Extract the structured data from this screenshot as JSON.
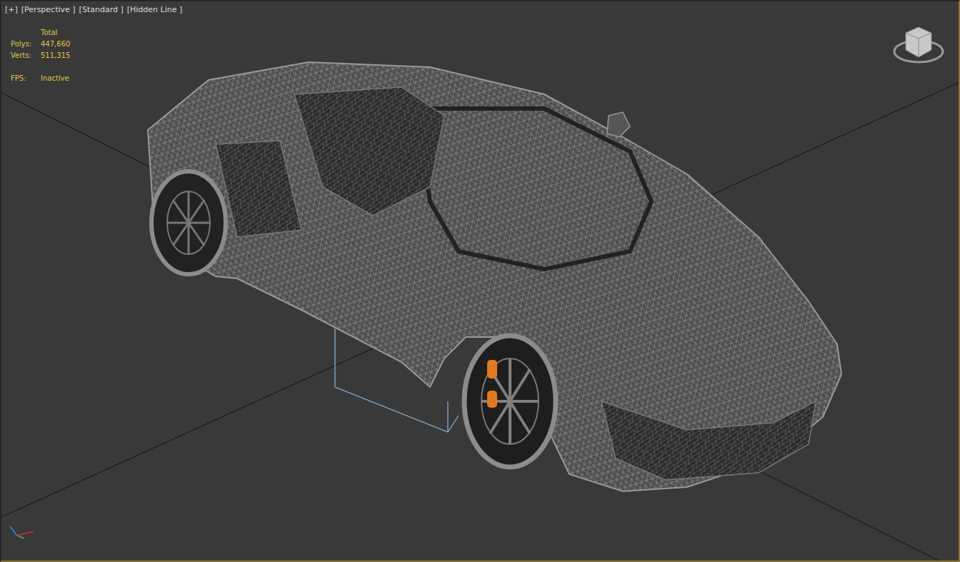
{
  "viewport": {
    "active": true,
    "labels": [
      {
        "text": "[+]"
      },
      {
        "text": "[Perspective ]"
      },
      {
        "text": "[Standard ]"
      },
      {
        "text": "[Hidden Line ]"
      }
    ]
  },
  "stats": {
    "header": "Total",
    "rows": [
      {
        "label": "Polys:",
        "value": "447,660"
      },
      {
        "label": "Verts:",
        "value": "511,315"
      }
    ],
    "fps": {
      "label": "FPS:",
      "value": "Inactive"
    }
  }
}
